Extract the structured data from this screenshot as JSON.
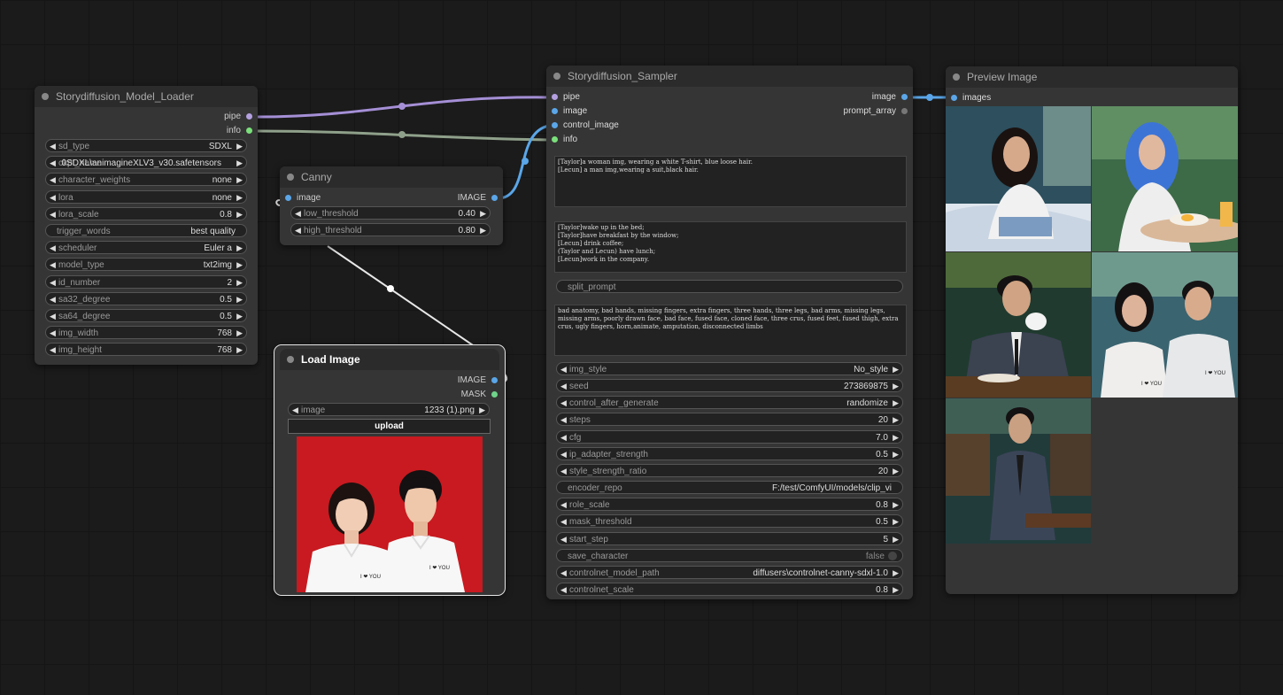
{
  "colors": {
    "canvas_bg": "#1b1b1b",
    "node_bg": "#353535",
    "pipe_link": "#a58fd6",
    "info_link": "#8fa08a",
    "image_link": "#5aa6e8",
    "mask_link": "#6fd38a"
  },
  "model_loader": {
    "title": "Storydiffusion_Model_Loader",
    "outputs": [
      "pipe",
      "info"
    ],
    "widgets": [
      {
        "label": "sd_type",
        "value": "SDXL",
        "type": "combo"
      },
      {
        "label": "ckpt_name",
        "value": "0SDXL\\animagineXLV3_v30.safetensors",
        "type": "combo"
      },
      {
        "label": "character_weights",
        "value": "none",
        "type": "combo"
      },
      {
        "label": "lora",
        "value": "none",
        "type": "combo"
      },
      {
        "label": "lora_scale",
        "value": "0.8",
        "type": "number"
      },
      {
        "label": "trigger_words",
        "value": "best quality",
        "type": "text"
      },
      {
        "label": "scheduler",
        "value": "Euler a",
        "type": "combo"
      },
      {
        "label": "model_type",
        "value": "txt2img",
        "type": "combo"
      },
      {
        "label": "id_number",
        "value": "2",
        "type": "number"
      },
      {
        "label": "sa32_degree",
        "value": "0.5",
        "type": "number"
      },
      {
        "label": "sa64_degree",
        "value": "0.5",
        "type": "number"
      },
      {
        "label": "img_width",
        "value": "768",
        "type": "number"
      },
      {
        "label": "img_height",
        "value": "768",
        "type": "number"
      }
    ]
  },
  "canny": {
    "title": "Canny",
    "input": "image",
    "output": "IMAGE",
    "widgets": [
      {
        "label": "low_threshold",
        "value": "0.40"
      },
      {
        "label": "high_threshold",
        "value": "0.80"
      }
    ]
  },
  "load_image": {
    "title": "Load Image",
    "outputs": [
      "IMAGE",
      "MASK"
    ],
    "image_widget": {
      "label": "image",
      "value": "1233 (1).png"
    },
    "upload_label": "upload",
    "badge_left": "I ❤ YOU",
    "badge_right": "I ❤ YOU"
  },
  "sampler": {
    "title": "Storydiffusion_Sampler",
    "inputs": [
      "pipe",
      "image",
      "control_image",
      "info"
    ],
    "outputs": [
      "image",
      "prompt_array"
    ],
    "character_prompt": "[Taylor]a woman img, wearing a white T-shirt, blue loose hair.\n[Lecun] a man img,wearing a suit,black hair.",
    "scene_prompts": "[Taylor]wake up in the bed;\n[Taylor]have breakfast by the window;\n[Lecun] drink coffee;\n(Taylor and Lecun) have lunch;\n[Lecun]work in the company.",
    "split_prompt_label": "split_prompt",
    "negative_prompt": "bad anatomy, bad hands, missing fingers, extra fingers, three hands, three legs, bad arms, missing legs, missing arms, poorly drawn face, bad face, fused face, cloned face, three crus, fused feet, fused thigh, extra crus, ugly fingers, horn,animate, amputation, disconnected limbs",
    "widgets": [
      {
        "label": "img_style",
        "value": "No_style",
        "type": "combo"
      },
      {
        "label": "seed",
        "value": "273869875",
        "type": "number"
      },
      {
        "label": "control_after_generate",
        "value": "randomize",
        "type": "combo"
      },
      {
        "label": "steps",
        "value": "20",
        "type": "number"
      },
      {
        "label": "cfg",
        "value": "7.0",
        "type": "number"
      },
      {
        "label": "ip_adapter_strength",
        "value": "0.5",
        "type": "number"
      },
      {
        "label": "style_strength_ratio",
        "value": "20",
        "type": "number"
      },
      {
        "label": "encoder_repo",
        "value": "F:/test/ComfyUI/models/clip_vi",
        "type": "text"
      },
      {
        "label": "role_scale",
        "value": "0.8",
        "type": "number"
      },
      {
        "label": "mask_threshold",
        "value": "0.5",
        "type": "number"
      },
      {
        "label": "start_step",
        "value": "5",
        "type": "number"
      },
      {
        "label": "save_character",
        "value": "false",
        "type": "toggle"
      },
      {
        "label": "controlnet_model_path",
        "value": "diffusers\\controlnet-canny-sdxl-1.0",
        "type": "combo"
      },
      {
        "label": "controlnet_scale",
        "value": "0.8",
        "type": "number"
      }
    ]
  },
  "preview": {
    "title": "Preview Image",
    "input": "images",
    "sign_text": "I ❤ YOU"
  }
}
